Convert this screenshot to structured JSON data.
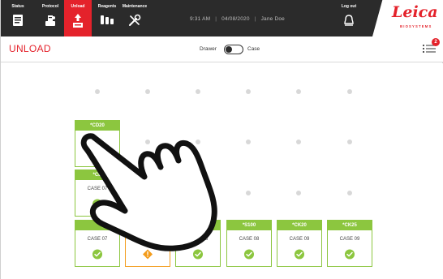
{
  "topbar": {
    "nav": [
      {
        "label": "Status",
        "icon": "status-icon"
      },
      {
        "label": "Protocol",
        "icon": "protocol-icon"
      },
      {
        "label": "Unload",
        "icon": "unload-icon",
        "active": true
      },
      {
        "label": "Reagents",
        "icon": "reagents-icon"
      },
      {
        "label": "Maintenance",
        "icon": "maintenance-icon"
      }
    ],
    "time": "9:31 AM",
    "date": "04/08/2020",
    "user": "Jane Doe",
    "logout_label": "Log out",
    "brand": {
      "logo": "Leica",
      "sub": "BIOSYSTEMS"
    }
  },
  "header": {
    "title": "UNLOAD",
    "toggle_left": "Drawer",
    "toggle_right": "Case",
    "badge_count": "2"
  },
  "cassettes": [
    {
      "id": "*CD20",
      "case": "",
      "status": "none"
    },
    {
      "id": "*CD",
      "case": "CASE 07",
      "status": "ok"
    },
    {
      "id": "",
      "case": "CASE 07",
      "status": "ok"
    },
    {
      "id": "",
      "case": "CASE 07",
      "status": "warn"
    },
    {
      "id": "*BF67",
      "case": "CASE 08",
      "status": "ok"
    },
    {
      "id": "*S100",
      "case": "CASE 08",
      "status": "ok"
    },
    {
      "id": "*CK20",
      "case": "CASE 09",
      "status": "ok"
    },
    {
      "id": "*CK25",
      "case": "CASE 09",
      "status": "ok"
    }
  ],
  "colors": {
    "accent": "#e4222b",
    "ok": "#8cc63f",
    "warn": "#f39c1c",
    "topbar": "#2b2b2b"
  }
}
